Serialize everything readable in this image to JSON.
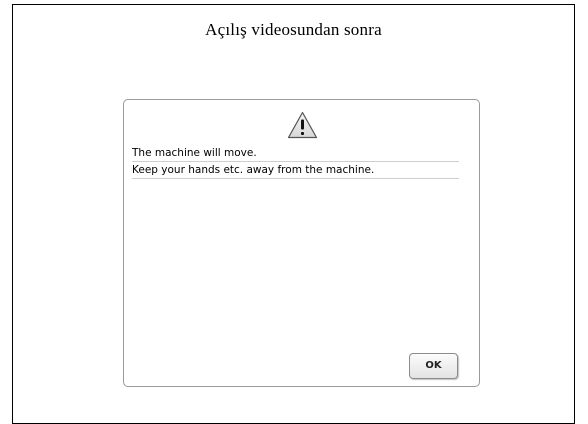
{
  "page": {
    "heading": "Açılış videosundan sonra"
  },
  "dialog": {
    "icon": "warning-triangle-icon",
    "lines": [
      "The machine will move.",
      "Keep your hands etc. away from the machine."
    ],
    "ok_label": "OK"
  },
  "colors": {
    "frame_border": "#000000",
    "dialog_border": "#9a9a9a",
    "icon_fill": "#e8e8e8"
  }
}
